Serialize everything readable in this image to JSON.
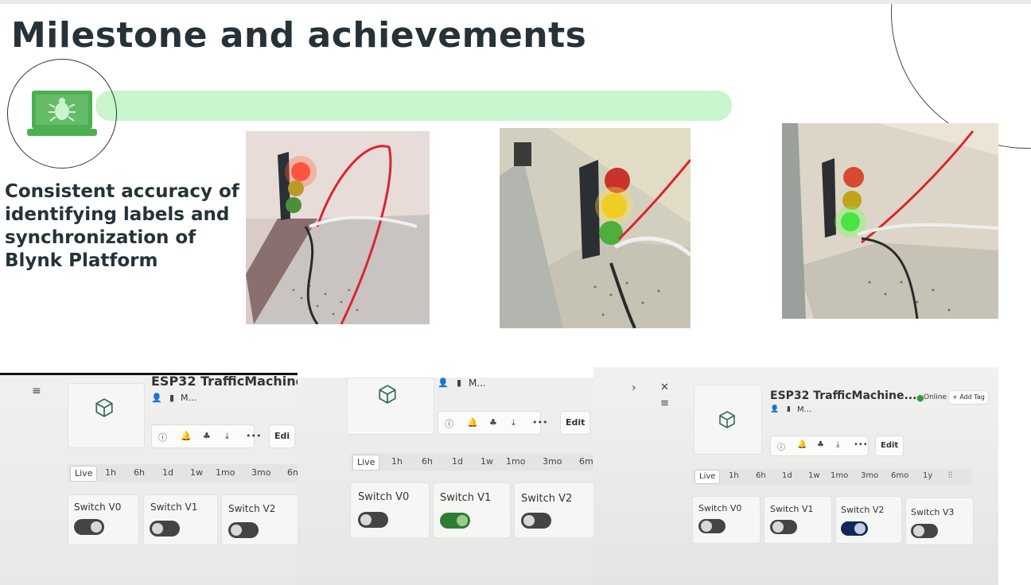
{
  "slide": {
    "title": "Milestone and achievements",
    "subtitle": "Consistent accuracy of identifying labels and synchronization of Blynk Platform"
  },
  "colors": {
    "title": "#263238",
    "accent_green": "#4caf50",
    "bar_green": "#c8f5cc",
    "toggle_on_green": "#2e7d32",
    "toggle_on_navy": "#0d2a5a"
  },
  "photos": [
    {
      "active_light": "red"
    },
    {
      "active_light": "yellow"
    },
    {
      "active_light": "green"
    }
  ],
  "dashboards": [
    {
      "device_title": "ESP32 TrafficMachine",
      "meta": "M...",
      "edit_label": "Edi",
      "time_ranges": [
        "Live",
        "1h",
        "6h",
        "1d",
        "1w",
        "1mo",
        "3mo",
        "6m"
      ],
      "switches": [
        {
          "label": "Switch V0",
          "state": "off"
        },
        {
          "label": "Switch V1",
          "state": "off"
        },
        {
          "label": "Switch V2",
          "state": "off"
        }
      ]
    },
    {
      "device_title": "",
      "meta": "M...",
      "edit_label": "Edit",
      "time_ranges": [
        "Live",
        "1h",
        "6h",
        "1d",
        "1w",
        "1mo",
        "3mo",
        "6m"
      ],
      "switches": [
        {
          "label": "Switch V0",
          "state": "off"
        },
        {
          "label": "Switch V1",
          "state": "on"
        },
        {
          "label": "Switch V2",
          "state": "off"
        }
      ]
    },
    {
      "device_title": "ESP32 TrafficMachine...",
      "status": "Online",
      "add_tag": "Add Tag",
      "meta": "M...",
      "edit_label": "Edit",
      "time_ranges": [
        "Live",
        "1h",
        "6h",
        "1d",
        "1w",
        "1mo",
        "3mo",
        "6mo",
        "1y"
      ],
      "switches": [
        {
          "label": "Switch V0",
          "state": "off"
        },
        {
          "label": "Switch V1",
          "state": "off"
        },
        {
          "label": "Switch V2",
          "state": "on"
        },
        {
          "label": "Switch V3",
          "state": "off"
        }
      ]
    }
  ]
}
